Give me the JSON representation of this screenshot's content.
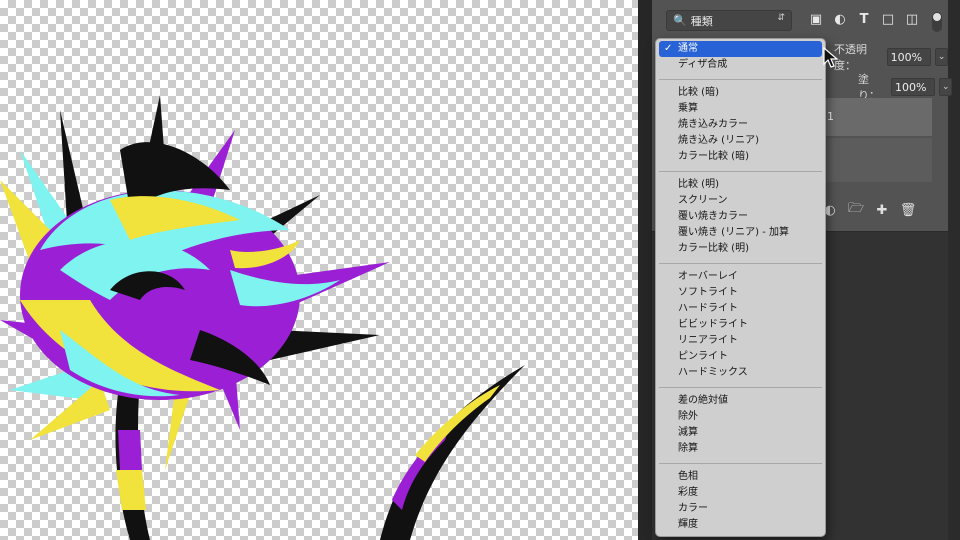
{
  "layers_panel": {
    "filter_kind": "種類",
    "filter_icons": [
      "image-filter-icon",
      "adjustment-filter-icon",
      "type-filter-icon",
      "shape-filter-icon",
      "smartobject-filter-icon"
    ],
    "opacity_label": "不透明度：",
    "opacity_value": "100%",
    "fill_label": "塗り：",
    "fill_value": "100%",
    "layer_name": "1",
    "bottom_icons": [
      "adjustment-layer-icon",
      "group-folder-icon",
      "new-layer-icon",
      "trash-icon"
    ]
  },
  "blend_menu": {
    "groups": [
      [
        {
          "label": "通常",
          "selected": true
        },
        {
          "label": "ディザ合成"
        }
      ],
      [
        {
          "label": "比較 (暗)"
        },
        {
          "label": "乗算"
        },
        {
          "label": "焼き込みカラー"
        },
        {
          "label": "焼き込み (リニア)"
        },
        {
          "label": "カラー比較 (暗)"
        }
      ],
      [
        {
          "label": "比較 (明)"
        },
        {
          "label": "スクリーン"
        },
        {
          "label": "覆い焼きカラー"
        },
        {
          "label": "覆い焼き (リニア) - 加算"
        },
        {
          "label": "カラー比較 (明)"
        }
      ],
      [
        {
          "label": "オーバーレイ"
        },
        {
          "label": "ソフトライト"
        },
        {
          "label": "ハードライト"
        },
        {
          "label": "ビビッドライト"
        },
        {
          "label": "リニアライト"
        },
        {
          "label": "ピンライト"
        },
        {
          "label": "ハードミックス"
        }
      ],
      [
        {
          "label": "差の絶対値"
        },
        {
          "label": "除外"
        },
        {
          "label": "減算"
        },
        {
          "label": "除算"
        }
      ],
      [
        {
          "label": "色相"
        },
        {
          "label": "彩度"
        },
        {
          "label": "カラー"
        },
        {
          "label": "輝度"
        }
      ]
    ]
  },
  "colors": {
    "selection_blue": "#2762d7",
    "panel_bg": "#535353",
    "menu_bg": "#cfcfcf",
    "art_purple": "#9b1fd4",
    "art_cyan": "#7ef3f0",
    "art_yellow": "#f2e23c",
    "art_black": "#111111"
  }
}
